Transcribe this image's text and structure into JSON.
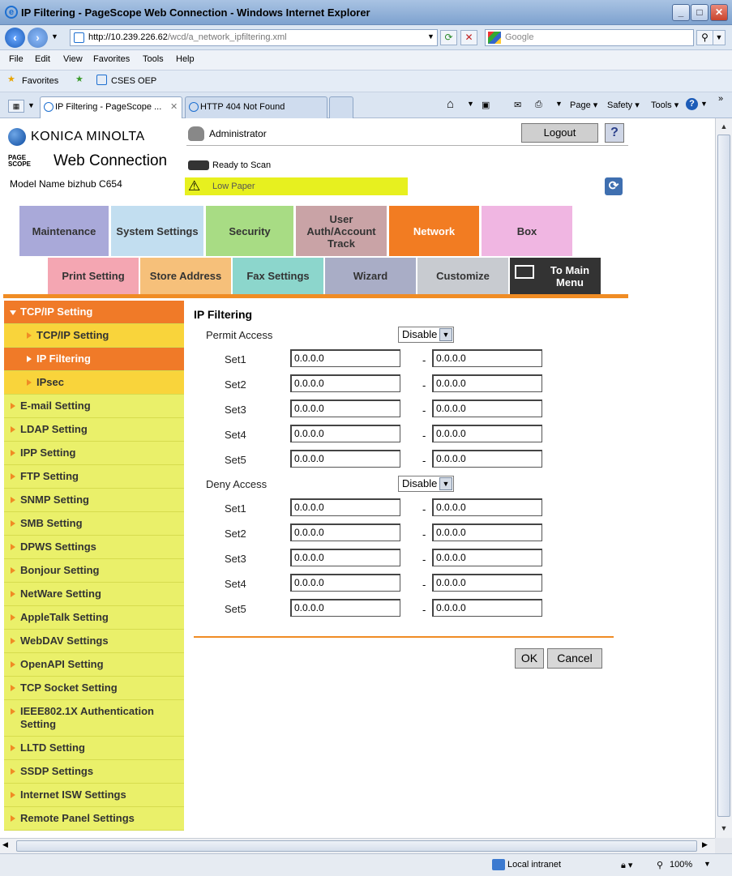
{
  "window": {
    "title": "IP Filtering - PageScope Web Connection - Windows Internet Explorer"
  },
  "address": {
    "host": "http://10.239.226.62",
    "path": "/wcd/a_network_ipfiltering.xml"
  },
  "search": {
    "placeholder": "Google"
  },
  "menubar": {
    "items": [
      "File",
      "Edit",
      "View",
      "Favorites",
      "Tools",
      "Help"
    ]
  },
  "favorites": {
    "label": "Favorites",
    "link": "CSES OEP"
  },
  "tabs": [
    {
      "label": "IP Filtering - PageScope ..."
    },
    {
      "label": "HTTP 404 Not Found"
    }
  ],
  "toolbar": {
    "page": "Page",
    "safety": "Safety",
    "tools": "Tools"
  },
  "header": {
    "brand": "KONICA MINOLTA",
    "product_small": "PAGE SCOPE",
    "product": "Web Connection",
    "model": "Model Name bizhub C654",
    "user": "Administrator",
    "logout": "Logout",
    "help": "?",
    "status_ready": "Ready to Scan",
    "status_warning": "Low Paper"
  },
  "main_tabs": [
    {
      "label": "Maintenance",
      "color": "#a9a9d9"
    },
    {
      "label": "System Settings",
      "color": "#c2def0"
    },
    {
      "label": "Security",
      "color": "#a8dc84"
    },
    {
      "label": "User Auth/Account Track",
      "color": "#c9a3a6"
    },
    {
      "label": "Network",
      "color": "#f27c22"
    },
    {
      "label": "Box",
      "color": "#f0b6e2"
    }
  ],
  "sub_tabs": [
    {
      "label": "Print Setting",
      "color": "#f4a6b2"
    },
    {
      "label": "Store Address",
      "color": "#f6c07a"
    },
    {
      "label": "Fax Settings",
      "color": "#8cd6cc"
    },
    {
      "label": "Wizard",
      "color": "#a9adc6"
    },
    {
      "label": "Customize",
      "color": "#c8cbd0"
    },
    {
      "label": "To Main Menu",
      "color": "#333333"
    }
  ],
  "sidebar": {
    "top": "TCP/IP Setting",
    "subs": [
      "TCP/IP Setting",
      "IP Filtering",
      "IPsec"
    ],
    "items": [
      "E-mail Setting",
      "LDAP Setting",
      "IPP Setting",
      "FTP Setting",
      "SNMP Setting",
      "SMB Setting",
      "DPWS Settings",
      "Bonjour Setting",
      "NetWare Setting",
      "AppleTalk Setting",
      "WebDAV Settings",
      "OpenAPI Setting",
      "TCP Socket Setting",
      "IEEE802.1X Authentication Setting",
      "LLTD Setting",
      "SSDP Settings",
      "Internet ISW Settings",
      "Remote Panel Settings"
    ]
  },
  "content": {
    "title": "IP Filtering",
    "permit": {
      "label": "Permit Access",
      "mode": "Disable",
      "sets": [
        {
          "name": "Set1",
          "from": "0.0.0.0",
          "to": "0.0.0.0"
        },
        {
          "name": "Set2",
          "from": "0.0.0.0",
          "to": "0.0.0.0"
        },
        {
          "name": "Set3",
          "from": "0.0.0.0",
          "to": "0.0.0.0"
        },
        {
          "name": "Set4",
          "from": "0.0.0.0",
          "to": "0.0.0.0"
        },
        {
          "name": "Set5",
          "from": "0.0.0.0",
          "to": "0.0.0.0"
        }
      ]
    },
    "deny": {
      "label": "Deny Access",
      "mode": "Disable",
      "sets": [
        {
          "name": "Set1",
          "from": "0.0.0.0",
          "to": "0.0.0.0"
        },
        {
          "name": "Set2",
          "from": "0.0.0.0",
          "to": "0.0.0.0"
        },
        {
          "name": "Set3",
          "from": "0.0.0.0",
          "to": "0.0.0.0"
        },
        {
          "name": "Set4",
          "from": "0.0.0.0",
          "to": "0.0.0.0"
        },
        {
          "name": "Set5",
          "from": "0.0.0.0",
          "to": "0.0.0.0"
        }
      ]
    },
    "range_sep": "-",
    "ok": "OK",
    "cancel": "Cancel"
  },
  "statusbar": {
    "zone": "Local intranet",
    "zoom": "100%"
  }
}
